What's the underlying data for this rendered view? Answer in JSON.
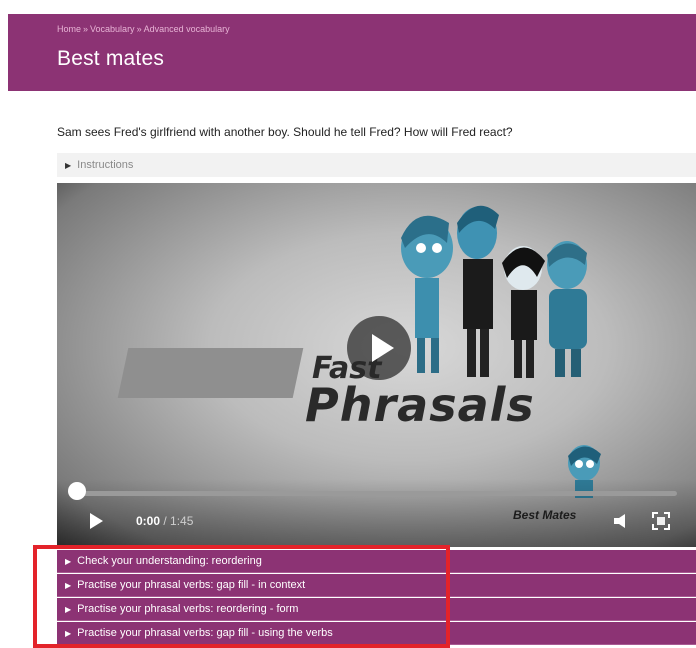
{
  "breadcrumb": {
    "items": [
      "Home",
      "Vocabulary",
      "Advanced vocabulary"
    ],
    "separator": "»"
  },
  "page": {
    "title": "Best mates",
    "intro": "Sam sees Fred's girlfriend with another boy. Should he tell Fred? How will Fred react?"
  },
  "instructions": {
    "label": "Instructions",
    "expanded": false
  },
  "video": {
    "logo_line1": "Fast",
    "logo_line2": "Phrasals",
    "brand_label": "Best Mates",
    "current_time": "0:00",
    "time_separator": " / ",
    "duration": "1:45",
    "progress_fraction": 0.0,
    "icons": [
      "play-icon",
      "volume-icon",
      "fullscreen-icon"
    ]
  },
  "tasks": [
    {
      "label": "Check your understanding: reordering"
    },
    {
      "label": "Practise your phrasal verbs: gap fill - in context"
    },
    {
      "label": "Practise your phrasal verbs: reordering - form"
    },
    {
      "label": "Practise your phrasal verbs: gap fill - using the verbs"
    }
  ],
  "colors": {
    "brand": "#8c3374",
    "highlight": "#e3232a",
    "breadcrumb": "#e7b3d5"
  }
}
